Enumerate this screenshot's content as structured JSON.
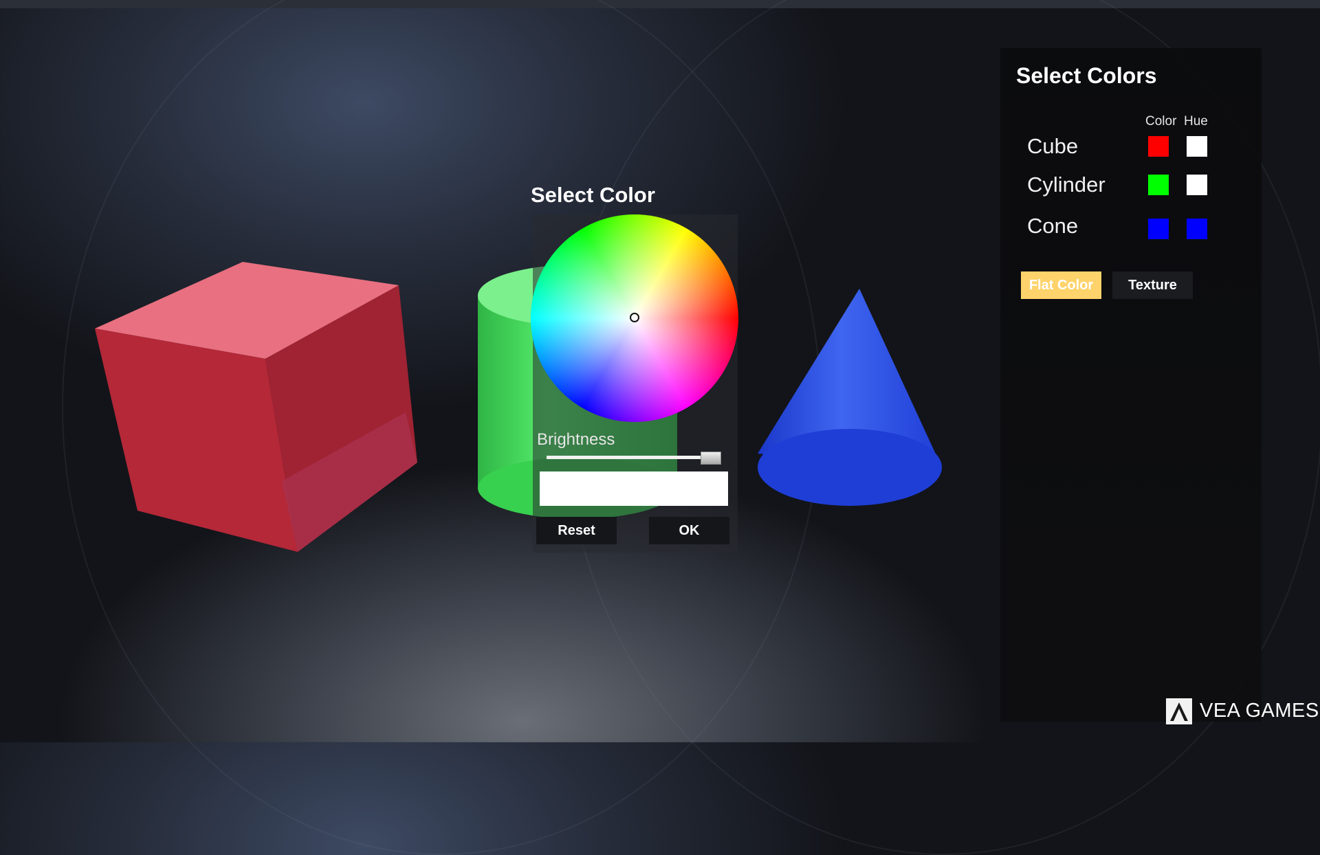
{
  "dialog": {
    "title": "Select Color",
    "brightness_label": "Brightness",
    "brightness_level": 0.95,
    "preview_color": "#ffffff",
    "reset_label": "Reset",
    "ok_label": "OK"
  },
  "panel": {
    "title": "Select Colors",
    "color_header": "Color",
    "hue_header": "Hue",
    "objects": [
      {
        "label": "Cube",
        "color": "#ff0000",
        "hue": "#ffffff"
      },
      {
        "label": "Cylinder",
        "color": "#00ff00",
        "hue": "#ffffff"
      },
      {
        "label": "Cone",
        "color": "#0000ff",
        "hue": "#0000ff"
      }
    ],
    "flat_color_label": "Flat Color",
    "texture_label": "Texture",
    "active_mode": "Flat Color"
  },
  "logo": {
    "text": "VEA GAMES",
    "icon": "vea-logo-icon"
  },
  "scene": {
    "cube_color": "#c93a4b",
    "cylinder_color": "#3fd957",
    "cone_color": "#2c4fe0"
  }
}
